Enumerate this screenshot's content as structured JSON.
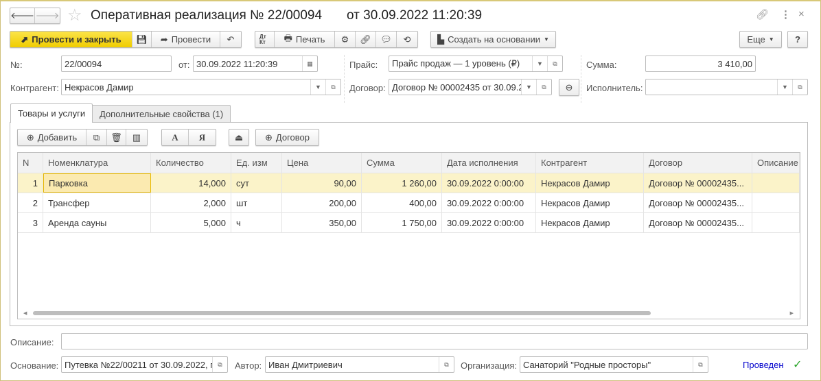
{
  "window": {
    "title": "Оперативная реализация № 22/00094",
    "date_title": "от 30.09.2022 11:20:39"
  },
  "toolbar": {
    "post_close": "Провести и закрыть",
    "post": "Провести",
    "print": "Печать",
    "dt_kt": "Дт Кт",
    "create_based": "Создать на основании",
    "more": "Еще",
    "help": "?"
  },
  "form": {
    "number_label": "№:",
    "number": "22/00094",
    "date_label": "от:",
    "date": "30.09.2022 11:20:39",
    "price_label": "Прайс:",
    "price": "Прайс продаж — 1 уровень (₽)",
    "sum_label": "Сумма:",
    "sum": "3 410,00",
    "counterparty_label": "Контрагент:",
    "counterparty": "Некрасов Дамир",
    "contract_label": "Договор:",
    "contract": "Договор № 00002435 от 30.09.2",
    "executor_label": "Исполнитель:",
    "executor": ""
  },
  "tabs": [
    {
      "label": "Товары и услуги"
    },
    {
      "label": "Дополнительные свойства (1)"
    }
  ],
  "table_toolbar": {
    "add": "Добавить",
    "sort_a": "А",
    "sort_ya": "Я",
    "contract": "Договор"
  },
  "table": {
    "columns": [
      "N",
      "Номенклатура",
      "Количество",
      "Ед. изм",
      "Цена",
      "Сумма",
      "Дата исполнения",
      "Контрагент",
      "Договор",
      "Описание"
    ],
    "rows": [
      [
        "1",
        "Парковка",
        "14,000",
        "сут",
        "90,00",
        "1 260,00",
        "30.09.2022 0:00:00",
        "Некрасов Дамир",
        "Договор № 00002435...",
        ""
      ],
      [
        "2",
        "Трансфер",
        "2,000",
        "шт",
        "200,00",
        "400,00",
        "30.09.2022 0:00:00",
        "Некрасов Дамир",
        "Договор № 00002435...",
        ""
      ],
      [
        "3",
        "Аренда сауны",
        "5,000",
        "ч",
        "350,00",
        "1 750,00",
        "30.09.2022 0:00:00",
        "Некрасов Дамир",
        "Договор № 00002435...",
        ""
      ]
    ]
  },
  "footer": {
    "description_label": "Описание:",
    "description": "",
    "basis_label": "Основание:",
    "basis": "Путевка №22/00211 от 30.09.2022, г",
    "author_label": "Автор:",
    "author": "Иван Дмитриевич",
    "org_label": "Организация:",
    "org": "Санаторий \"Родные просторы\"",
    "status": "Проведен"
  },
  "colors": {
    "accent": "#f5d80f",
    "selected_row": "#fbf3c9",
    "status": "#0000cc",
    "check": "#2aa52a"
  }
}
